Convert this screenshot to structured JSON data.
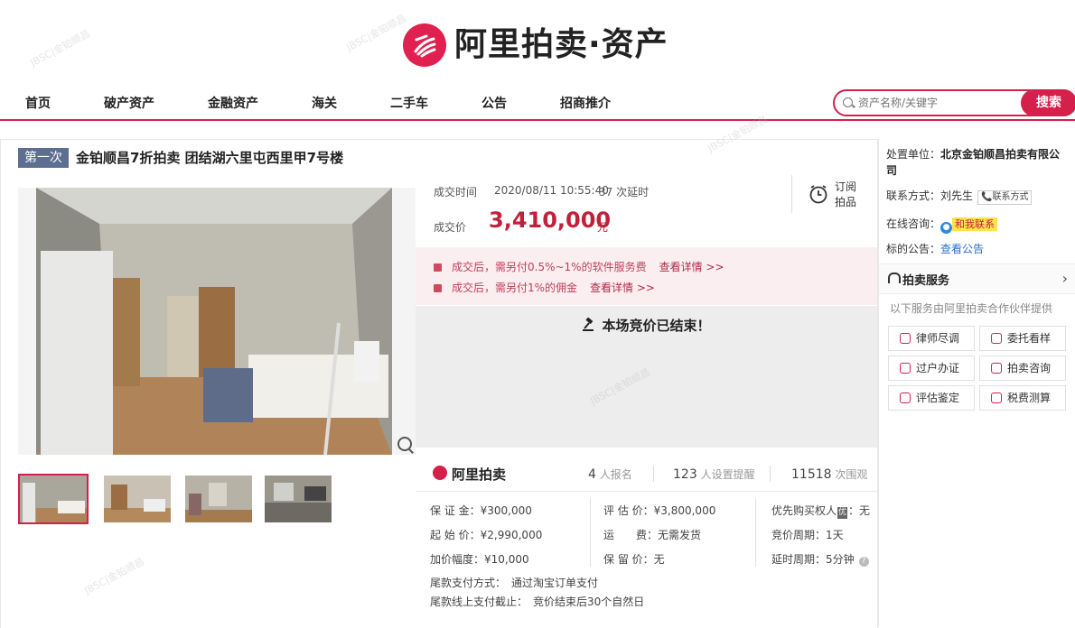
{
  "brand": {
    "name": "阿里拍卖·资产",
    "short": "阿里拍卖"
  },
  "nav": {
    "items": [
      "首页",
      "破产资产",
      "金融资产",
      "海关",
      "二手车",
      "公告",
      "招商推介"
    ]
  },
  "search": {
    "placeholder": "资产名称/关键字",
    "button": "搜索"
  },
  "listing": {
    "badge": "第一次",
    "title": "金铂顺昌7折拍卖 团结湖六里屯西里甲7号楼"
  },
  "result": {
    "time_label": "成交时间",
    "time_value": "2020/08/11 10:55:40",
    "delay": "37 次延时",
    "price_label": "成交价",
    "price": "3,410,000",
    "price_unit": "元",
    "subscribe": [
      "订阅",
      "拍品"
    ]
  },
  "fees": [
    {
      "text": "成交后，需另付0.5%~1%的软件服务费",
      "link": "查看详情 >>"
    },
    {
      "text": "成交后，需另付1%的佣金",
      "link": "查看详情 >>"
    }
  ],
  "ended": {
    "text": "本场竞价已结束！"
  },
  "stats": {
    "signups": "4",
    "signups_label": "人报名",
    "reminders": "123",
    "reminders_label": "人设置提醒",
    "views": "11518",
    "views_label": "次围观"
  },
  "info": {
    "deposit": "保 证 金：¥300,000",
    "start_price": "起 始 价：¥2,990,000",
    "increment": "加价幅度：¥10,000",
    "appraisal": "评 估 价：¥3,800,000",
    "shipping": "运　　费：无需发货",
    "reserve": "保 留 价：无",
    "priority_label": "优先购买权人",
    "priority_tag": "优",
    "priority_value": "：无",
    "cycle": "竞价周期：1天",
    "delay_cycle": "延时周期：5分钟",
    "payment_label": "尾款支付方式：",
    "payment_value": "通过淘宝订单支付",
    "deadline_label": "尾款线上支付截止：",
    "deadline_value": "竞价结束后30个自然日"
  },
  "side": {
    "disposer_label": "处置单位：",
    "disposer_value": "北京金铂顺昌拍卖有限公司",
    "contact_label": "联系方式：",
    "contact_name": "刘先生",
    "contact_tag": "联系方式",
    "consult_label": "在线咨询：",
    "consult_value": "和我联系",
    "notice_label": "标的公告：",
    "notice_value": "查看公告",
    "service_title": "拍卖服务",
    "service_desc": "以下服务由阿里拍卖合作伙伴提供",
    "services": [
      "律师尽调",
      "委托看样",
      "过户办证",
      "拍卖咨询",
      "评估鉴定",
      "税费测算"
    ]
  },
  "watermark": "JBSC|金铂顺昌",
  "colors": {
    "brand": "#d4204b",
    "price": "#c0203a",
    "badge": "#5c6e91"
  }
}
